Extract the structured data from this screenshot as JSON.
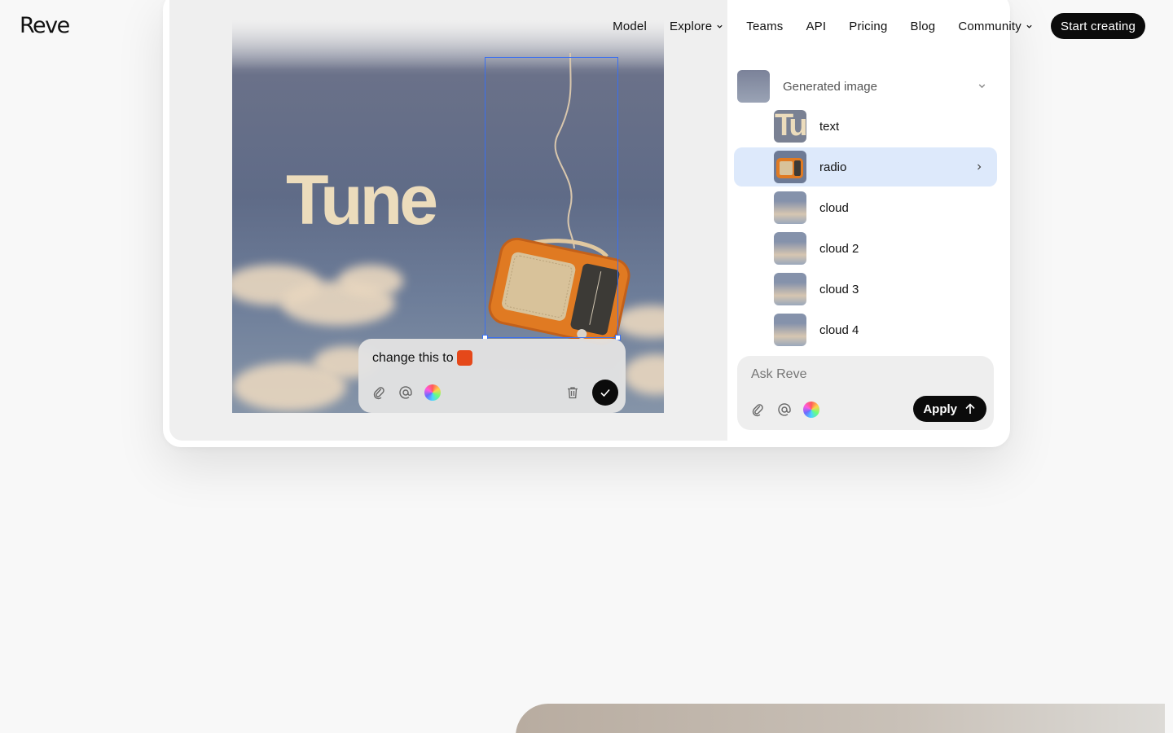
{
  "brand": {
    "logo": "Reve"
  },
  "nav": {
    "links": [
      {
        "label": "Model",
        "dropdown": false
      },
      {
        "label": "Explore",
        "dropdown": true
      },
      {
        "label": "Teams",
        "dropdown": false
      },
      {
        "label": "API",
        "dropdown": false
      },
      {
        "label": "Pricing",
        "dropdown": false
      },
      {
        "label": "Blog",
        "dropdown": false
      },
      {
        "label": "Community",
        "dropdown": true
      }
    ],
    "cta_label": "Start creating"
  },
  "canvas": {
    "poster_title": "Tune",
    "edit_popup": {
      "text": "change this to",
      "swatch_color": "#e5481a",
      "icons": [
        "paperclip-icon",
        "at-icon",
        "color-wheel-icon",
        "trash-icon",
        "check-icon"
      ]
    }
  },
  "layers": {
    "root": {
      "label": "Generated image"
    },
    "items": [
      {
        "label": "text",
        "selected": false
      },
      {
        "label": "radio",
        "selected": true
      },
      {
        "label": "cloud",
        "selected": false
      },
      {
        "label": "cloud 2",
        "selected": false
      },
      {
        "label": "cloud 3",
        "selected": false
      },
      {
        "label": "cloud 4",
        "selected": false
      }
    ]
  },
  "ask": {
    "placeholder": "Ask Reve",
    "apply_label": "Apply",
    "icons": [
      "paperclip-icon",
      "at-icon",
      "color-wheel-icon",
      "arrow-up-icon"
    ]
  },
  "colors": {
    "accent_selection": "#3a6ff0",
    "selected_row": "#dde9fb",
    "button_dark": "#0b0b0b"
  }
}
